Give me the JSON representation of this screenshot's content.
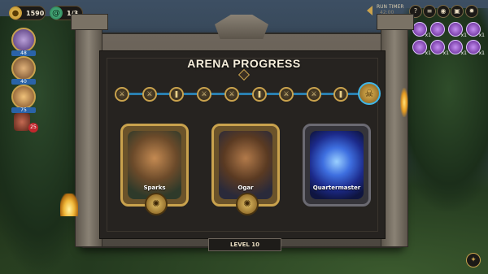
{
  "hud": {
    "gold": "1590",
    "lives": "1/3",
    "run_timer_label": "RUN TIMER",
    "run_timer_value": "42:00"
  },
  "party": [
    {
      "hp": "48"
    },
    {
      "hp": "40"
    },
    {
      "hp": "75"
    }
  ],
  "enemy_badge": "25",
  "relics": [
    {
      "count": "x1"
    },
    {
      "count": ""
    },
    {
      "count": "x1"
    },
    {
      "count": "x1"
    },
    {
      "count": "x1"
    },
    {
      "count": "x1"
    },
    {
      "count": "x1"
    },
    {
      "count": "x1"
    }
  ],
  "title": "ARENA PROGRESS",
  "track": {
    "node_icons": [
      "⚔",
      "⚔",
      "❚",
      "⚔",
      "⚔",
      "❚",
      "⚔",
      "⚔",
      "❚"
    ],
    "final_icon": "☠"
  },
  "cards": [
    {
      "name": "Sparks"
    },
    {
      "name": "Ogar"
    },
    {
      "name": "Quartermaster"
    }
  ],
  "level": "LEVEL 10",
  "colors": {
    "accent_gold": "#c9a24d",
    "track_blue": "#2a7fb0"
  }
}
